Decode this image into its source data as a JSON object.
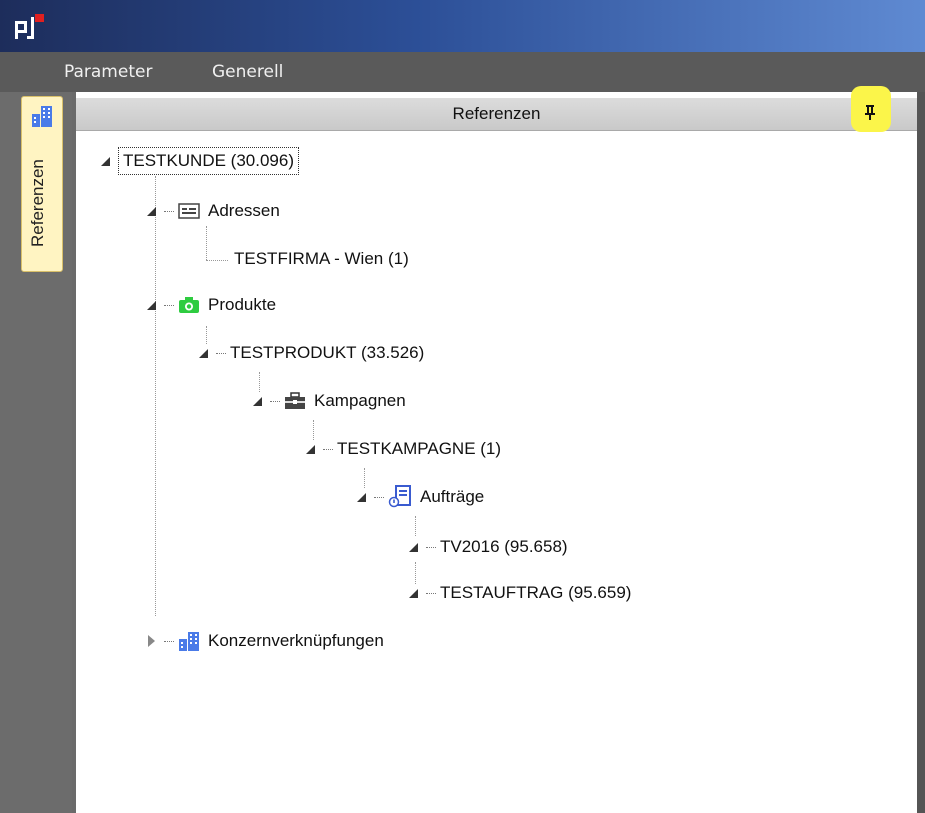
{
  "app": {
    "logo": "app-logo-icon"
  },
  "menu": {
    "items": [
      "Parameter",
      "Generell"
    ]
  },
  "sidebar": {
    "tab_label": "Referenzen",
    "tab_icon": "buildings-icon"
  },
  "panel": {
    "title": "Referenzen",
    "pin_icon": "pin-icon",
    "highlight_color": "#fbf54a"
  },
  "tree": {
    "root": "TESTKUNDE (30.096)",
    "adressen": "Adressen",
    "adresse_1": "TESTFIRMA - Wien (1)",
    "produkte": "Produkte",
    "produkt_1": "TESTPRODUKT (33.526)",
    "kampagnen": "Kampagnen",
    "kampagne_1": "TESTKAMPAGNE (1)",
    "auftraege": "Aufträge",
    "auftrag_1": "TV2016 (95.658)",
    "auftrag_2": "TESTAUFTRAG (95.659)",
    "konzern": "Konzernverknüpfungen"
  },
  "colors": {
    "title_bar": "#2c4f97",
    "menu_bar": "#5a5a5a",
    "camera": "#2ecc40",
    "blue_icon": "#3a5bd0"
  }
}
